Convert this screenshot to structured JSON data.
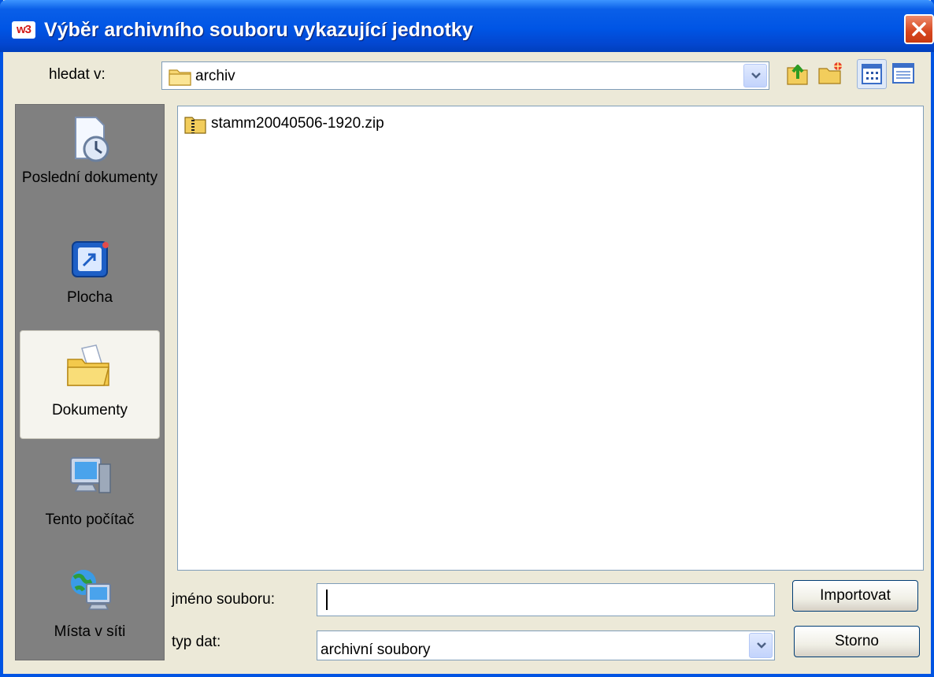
{
  "window": {
    "app_icon_text": "w3",
    "title": "Výběr archivního souboru vykazující jednotky"
  },
  "lookin": {
    "label": "hledat v:",
    "value": "archiv"
  },
  "toolbar": {
    "icons": [
      "up-folder-icon",
      "new-folder-icon",
      "list-view-icon",
      "details-view-icon"
    ]
  },
  "places": [
    {
      "label": "Poslední dokumenty",
      "icon": "recent-documents-icon"
    },
    {
      "label": "Plocha",
      "icon": "desktop-icon"
    },
    {
      "label": "Dokumenty",
      "icon": "my-documents-icon",
      "selected": true
    },
    {
      "label": "Tento počítač",
      "icon": "my-computer-icon"
    },
    {
      "label": "Místa v síti",
      "icon": "network-places-icon"
    }
  ],
  "files": [
    {
      "name": "stamm20040506-1920.zip",
      "icon": "zip-folder-icon"
    }
  ],
  "filename": {
    "label": "jméno souboru:",
    "value": ""
  },
  "filetype": {
    "label": "typ dat:",
    "value": "archivní soubory"
  },
  "buttons": {
    "import": "Importovat",
    "cancel": "Storno"
  }
}
